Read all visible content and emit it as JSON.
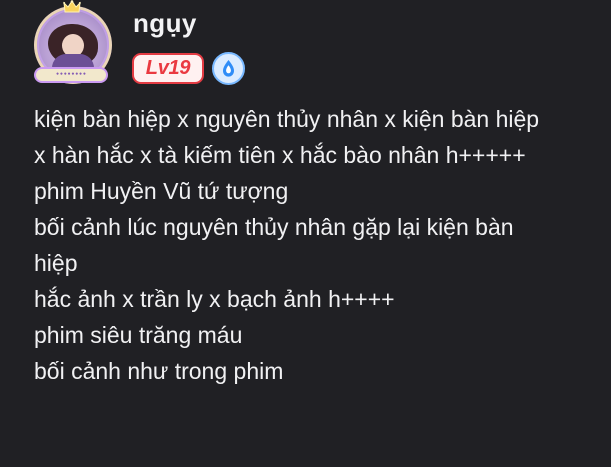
{
  "profile": {
    "username": "ngụy",
    "level": "Lv19",
    "avatar_label": "••••••••"
  },
  "post": {
    "lines": [
      "kiện bàn hiệp x nguyên thủy nhân x kiện bàn hiệp",
      "x hàn hắc x tà kiếm tiên x hắc bào nhân h+++++",
      "phim Huyền Vũ tứ tượng",
      "bối cảnh lúc nguyên thủy nhân gặp lại kiện bàn",
      "hiệp",
      "hắc ảnh x trần ly x bạch ảnh h++++",
      "phim siêu trăng máu",
      "bối cảnh như trong phim"
    ]
  },
  "icons": {
    "avatar": "anime-avatar-icon",
    "crown": "crown-icon",
    "verified": "water-drop-verified-icon"
  },
  "colors": {
    "background": "#202024",
    "text": "#f1f1f3",
    "level_red": "#ea3941",
    "level_bg": "#fff1f1",
    "verify_blue": "#2f8df7",
    "verify_bg": "#dcecff"
  }
}
